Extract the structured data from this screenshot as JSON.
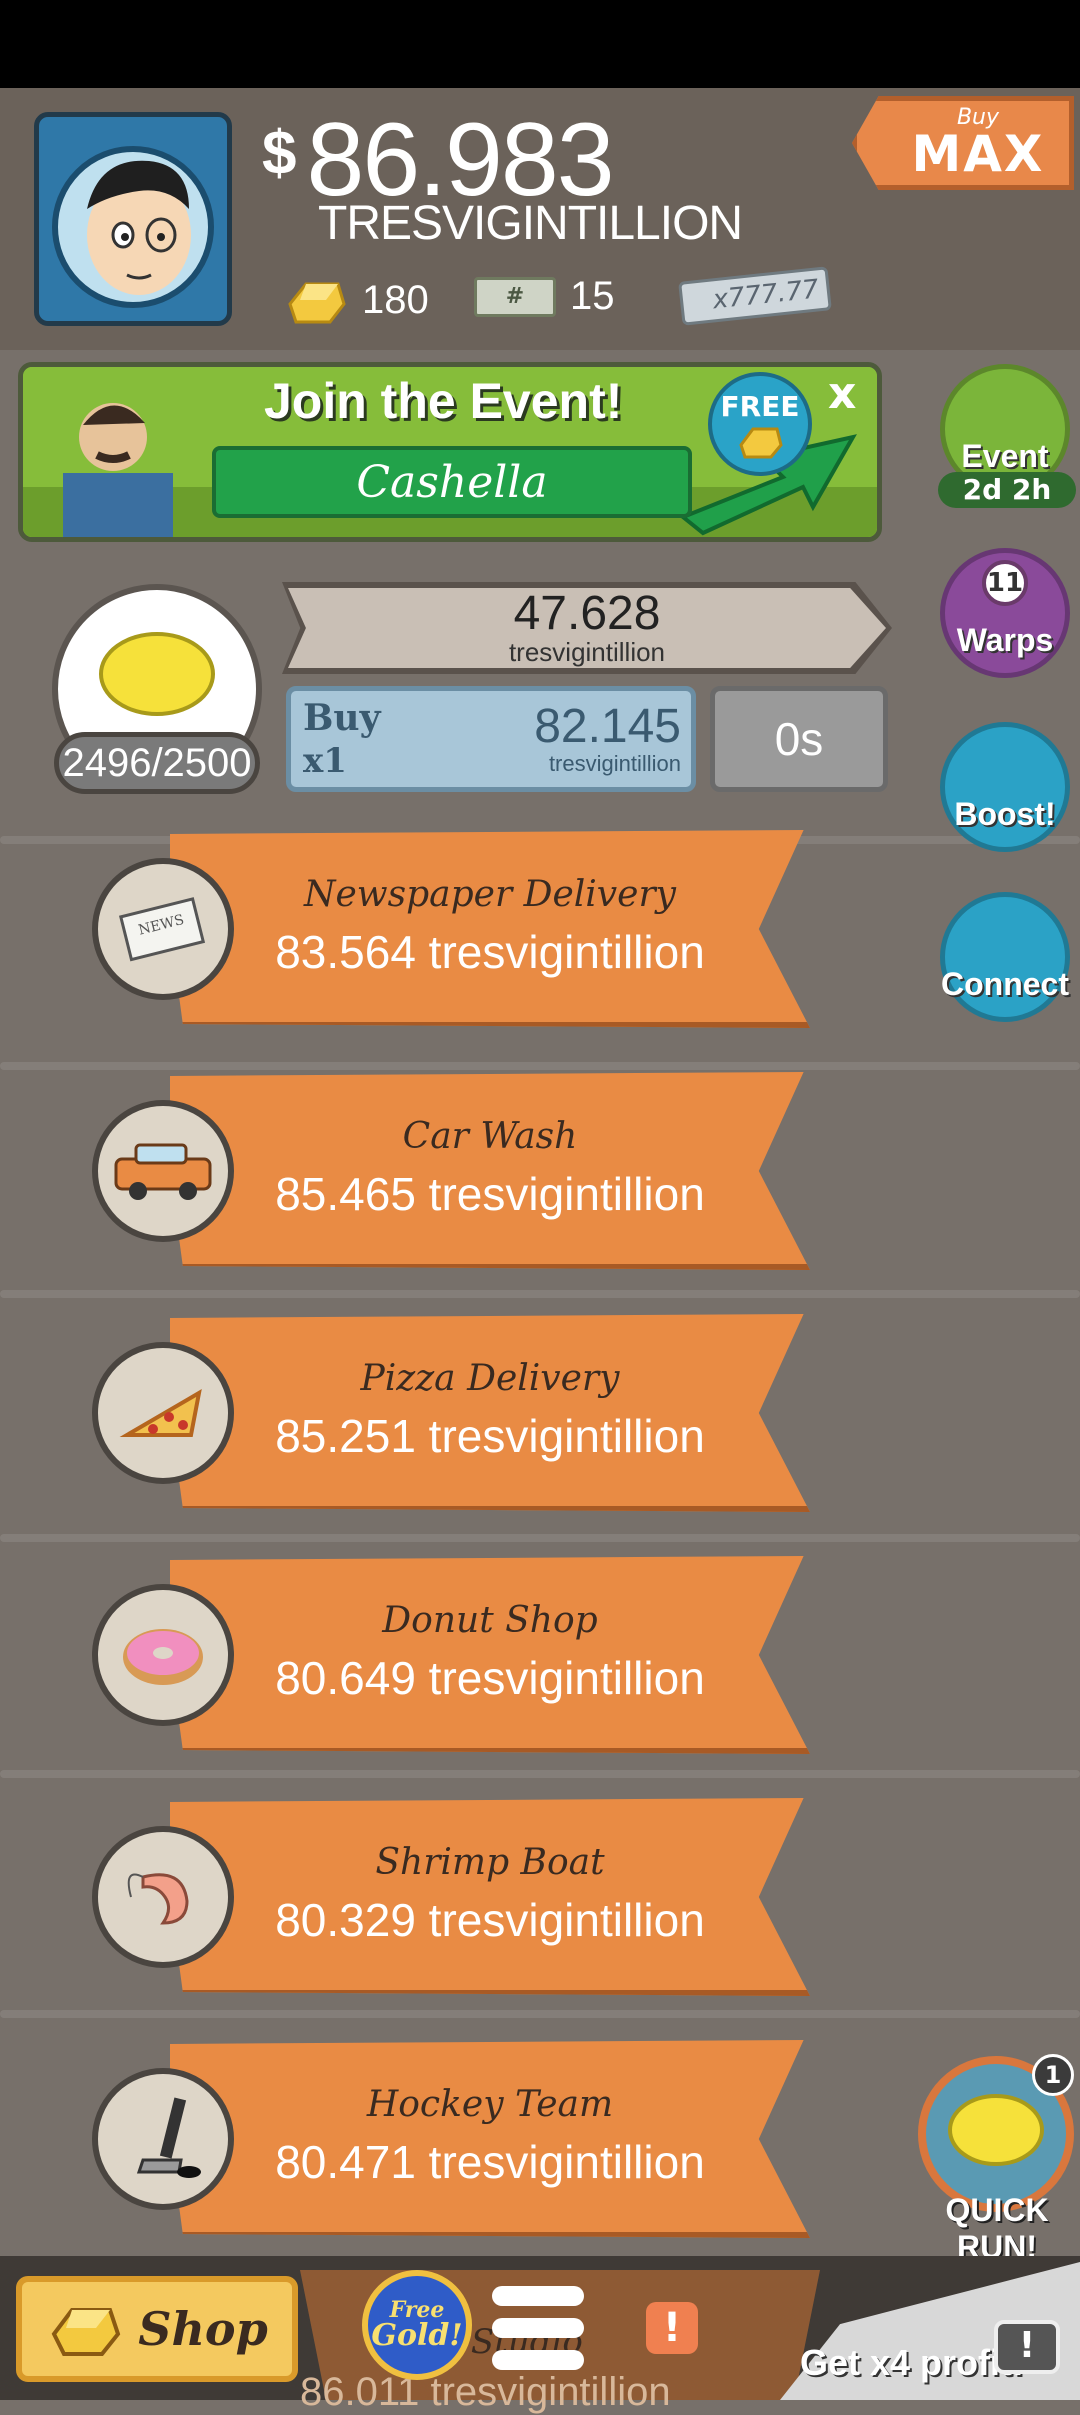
{
  "header": {
    "currency_symbol": "$",
    "money_value": "86.983",
    "money_unit": "TRESVIGINTILLION",
    "gold_count": "180",
    "megabucks_count": "15",
    "mega_ticket_multiplier": "x777.77",
    "buy_max_small": "Buy",
    "buy_max_big": "MAX"
  },
  "event": {
    "title": "Join the Event!",
    "name": "Cashella",
    "free_label": "FREE",
    "close_label": "x"
  },
  "side_buttons": {
    "event_label": "Event",
    "event_timer": "2d 2h",
    "warps_count": "11",
    "warps_label": "Warps",
    "boost_label": "Boost!",
    "connect_label": "Connect"
  },
  "lemonade": {
    "progress_text": "2496/2500",
    "profit_value": "47.628",
    "profit_unit": "tresvigintillion",
    "buy_label": "Buy",
    "buy_qty": "x1",
    "buy_cost_value": "82.145",
    "buy_cost_unit": "tresvigintillion",
    "timer": "0s"
  },
  "businesses": [
    {
      "name": "Newspaper Delivery",
      "value": "83.564 tresvigintillion",
      "icon": "newspaper-icon"
    },
    {
      "name": "Car Wash",
      "value": "85.465 tresvigintillion",
      "icon": "car-icon"
    },
    {
      "name": "Pizza Delivery",
      "value": "85.251 tresvigintillion",
      "icon": "pizza-icon"
    },
    {
      "name": "Donut Shop",
      "value": "80.649 tresvigintillion",
      "icon": "donut-icon"
    },
    {
      "name": "Shrimp Boat",
      "value": "80.329 tresvigintillion",
      "icon": "shrimp-icon"
    },
    {
      "name": "Hockey Team",
      "value": "80.471 tresvigintillion",
      "icon": "hockey-stick-icon"
    }
  ],
  "quick_run": {
    "badge": "1",
    "label": "QUICK RUN!"
  },
  "bottom_bar": {
    "shop_label": "Shop",
    "free_gold_top": "Free",
    "free_gold_bottom": "Gold!",
    "alert_label": "!",
    "x4_label": "Get x4 profit!",
    "next_business_partial": "e Studio",
    "next_business_value_partial": "86.011 tresvigintillion"
  },
  "colors": {
    "background": "#77706a",
    "business_ribbon": "#e98b44",
    "event_green": "#22a24a",
    "buy_box": "#a8c6d8"
  }
}
